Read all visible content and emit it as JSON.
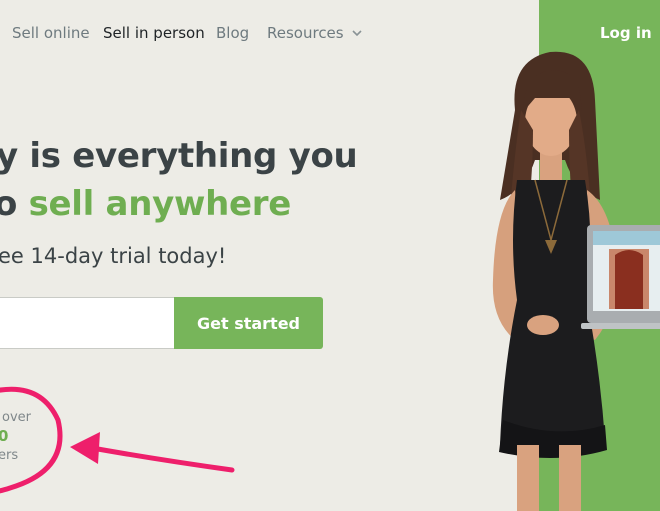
{
  "nav": {
    "items": [
      {
        "label": "Sell online"
      },
      {
        "label": "Sell in person"
      },
      {
        "label": "Blog"
      },
      {
        "label": "Resources"
      }
    ],
    "login_label": "Log in",
    "chevron_icon": "chevron-down-icon"
  },
  "hero": {
    "headline_line1": "y is everything you",
    "headline_line2_prefix": "o ",
    "headline_line2_highlight": "sell anywhere",
    "subhead": "ee 14-day trial today!",
    "cta_label": "Get started"
  },
  "trust": {
    "line1": "over",
    "number": "0",
    "line3": "ers"
  },
  "colors": {
    "brand_green": "#77b55a",
    "annotation_pink": "#ee1f6b",
    "background": "#edece6"
  }
}
